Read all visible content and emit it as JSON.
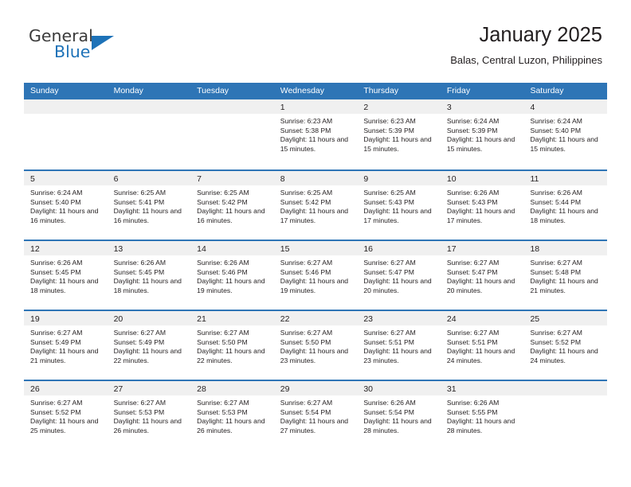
{
  "logo": {
    "part1": "General",
    "part2": "Blue",
    "triangle_color": "#1d72b8",
    "text_color": "#3b3b3b"
  },
  "header": {
    "title": "January 2025",
    "subtitle": "Balas, Central Luzon, Philippines"
  },
  "theme": {
    "header_blue": "#2e75b6",
    "day_band_gray": "#f0f0f0",
    "text": "#231f20"
  },
  "weekdays": [
    "Sunday",
    "Monday",
    "Tuesday",
    "Wednesday",
    "Thursday",
    "Friday",
    "Saturday"
  ],
  "labels": {
    "sunrise": "Sunrise:",
    "sunset": "Sunset:",
    "daylight": "Daylight:"
  },
  "weeks": [
    [
      {
        "empty": true
      },
      {
        "empty": true
      },
      {
        "empty": true
      },
      {
        "day": "1",
        "sunrise": "Sunrise: 6:23 AM",
        "sunset": "Sunset: 5:38 PM",
        "daylight": "Daylight: 11 hours and 15 minutes."
      },
      {
        "day": "2",
        "sunrise": "Sunrise: 6:23 AM",
        "sunset": "Sunset: 5:39 PM",
        "daylight": "Daylight: 11 hours and 15 minutes."
      },
      {
        "day": "3",
        "sunrise": "Sunrise: 6:24 AM",
        "sunset": "Sunset: 5:39 PM",
        "daylight": "Daylight: 11 hours and 15 minutes."
      },
      {
        "day": "4",
        "sunrise": "Sunrise: 6:24 AM",
        "sunset": "Sunset: 5:40 PM",
        "daylight": "Daylight: 11 hours and 15 minutes."
      }
    ],
    [
      {
        "day": "5",
        "sunrise": "Sunrise: 6:24 AM",
        "sunset": "Sunset: 5:40 PM",
        "daylight": "Daylight: 11 hours and 16 minutes."
      },
      {
        "day": "6",
        "sunrise": "Sunrise: 6:25 AM",
        "sunset": "Sunset: 5:41 PM",
        "daylight": "Daylight: 11 hours and 16 minutes."
      },
      {
        "day": "7",
        "sunrise": "Sunrise: 6:25 AM",
        "sunset": "Sunset: 5:42 PM",
        "daylight": "Daylight: 11 hours and 16 minutes."
      },
      {
        "day": "8",
        "sunrise": "Sunrise: 6:25 AM",
        "sunset": "Sunset: 5:42 PM",
        "daylight": "Daylight: 11 hours and 17 minutes."
      },
      {
        "day": "9",
        "sunrise": "Sunrise: 6:25 AM",
        "sunset": "Sunset: 5:43 PM",
        "daylight": "Daylight: 11 hours and 17 minutes."
      },
      {
        "day": "10",
        "sunrise": "Sunrise: 6:26 AM",
        "sunset": "Sunset: 5:43 PM",
        "daylight": "Daylight: 11 hours and 17 minutes."
      },
      {
        "day": "11",
        "sunrise": "Sunrise: 6:26 AM",
        "sunset": "Sunset: 5:44 PM",
        "daylight": "Daylight: 11 hours and 18 minutes."
      }
    ],
    [
      {
        "day": "12",
        "sunrise": "Sunrise: 6:26 AM",
        "sunset": "Sunset: 5:45 PM",
        "daylight": "Daylight: 11 hours and 18 minutes."
      },
      {
        "day": "13",
        "sunrise": "Sunrise: 6:26 AM",
        "sunset": "Sunset: 5:45 PM",
        "daylight": "Daylight: 11 hours and 18 minutes."
      },
      {
        "day": "14",
        "sunrise": "Sunrise: 6:26 AM",
        "sunset": "Sunset: 5:46 PM",
        "daylight": "Daylight: 11 hours and 19 minutes."
      },
      {
        "day": "15",
        "sunrise": "Sunrise: 6:27 AM",
        "sunset": "Sunset: 5:46 PM",
        "daylight": "Daylight: 11 hours and 19 minutes."
      },
      {
        "day": "16",
        "sunrise": "Sunrise: 6:27 AM",
        "sunset": "Sunset: 5:47 PM",
        "daylight": "Daylight: 11 hours and 20 minutes."
      },
      {
        "day": "17",
        "sunrise": "Sunrise: 6:27 AM",
        "sunset": "Sunset: 5:47 PM",
        "daylight": "Daylight: 11 hours and 20 minutes."
      },
      {
        "day": "18",
        "sunrise": "Sunrise: 6:27 AM",
        "sunset": "Sunset: 5:48 PM",
        "daylight": "Daylight: 11 hours and 21 minutes."
      }
    ],
    [
      {
        "day": "19",
        "sunrise": "Sunrise: 6:27 AM",
        "sunset": "Sunset: 5:49 PM",
        "daylight": "Daylight: 11 hours and 21 minutes."
      },
      {
        "day": "20",
        "sunrise": "Sunrise: 6:27 AM",
        "sunset": "Sunset: 5:49 PM",
        "daylight": "Daylight: 11 hours and 22 minutes."
      },
      {
        "day": "21",
        "sunrise": "Sunrise: 6:27 AM",
        "sunset": "Sunset: 5:50 PM",
        "daylight": "Daylight: 11 hours and 22 minutes."
      },
      {
        "day": "22",
        "sunrise": "Sunrise: 6:27 AM",
        "sunset": "Sunset: 5:50 PM",
        "daylight": "Daylight: 11 hours and 23 minutes."
      },
      {
        "day": "23",
        "sunrise": "Sunrise: 6:27 AM",
        "sunset": "Sunset: 5:51 PM",
        "daylight": "Daylight: 11 hours and 23 minutes."
      },
      {
        "day": "24",
        "sunrise": "Sunrise: 6:27 AM",
        "sunset": "Sunset: 5:51 PM",
        "daylight": "Daylight: 11 hours and 24 minutes."
      },
      {
        "day": "25",
        "sunrise": "Sunrise: 6:27 AM",
        "sunset": "Sunset: 5:52 PM",
        "daylight": "Daylight: 11 hours and 24 minutes."
      }
    ],
    [
      {
        "day": "26",
        "sunrise": "Sunrise: 6:27 AM",
        "sunset": "Sunset: 5:52 PM",
        "daylight": "Daylight: 11 hours and 25 minutes."
      },
      {
        "day": "27",
        "sunrise": "Sunrise: 6:27 AM",
        "sunset": "Sunset: 5:53 PM",
        "daylight": "Daylight: 11 hours and 26 minutes."
      },
      {
        "day": "28",
        "sunrise": "Sunrise: 6:27 AM",
        "sunset": "Sunset: 5:53 PM",
        "daylight": "Daylight: 11 hours and 26 minutes."
      },
      {
        "day": "29",
        "sunrise": "Sunrise: 6:27 AM",
        "sunset": "Sunset: 5:54 PM",
        "daylight": "Daylight: 11 hours and 27 minutes."
      },
      {
        "day": "30",
        "sunrise": "Sunrise: 6:26 AM",
        "sunset": "Sunset: 5:54 PM",
        "daylight": "Daylight: 11 hours and 28 minutes."
      },
      {
        "day": "31",
        "sunrise": "Sunrise: 6:26 AM",
        "sunset": "Sunset: 5:55 PM",
        "daylight": "Daylight: 11 hours and 28 minutes."
      },
      {
        "empty": true
      }
    ]
  ]
}
